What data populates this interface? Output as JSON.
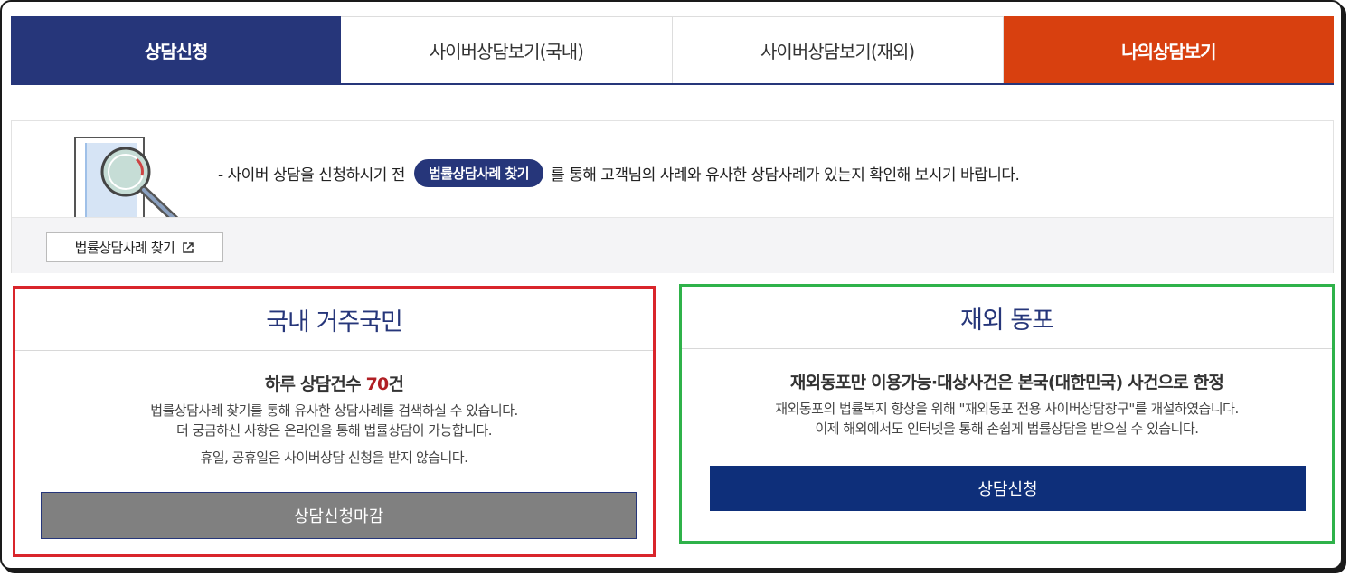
{
  "tabs": [
    {
      "label": "상담신청"
    },
    {
      "label": "사이버상담보기(국내)"
    },
    {
      "label": "사이버상담보기(재외)"
    },
    {
      "label": "나의상담보기"
    }
  ],
  "notice": {
    "prefix": "- 사이버 상담을 신청하시기 전",
    "pill_label": "법률상담사례 찾기",
    "suffix": "를 통해 고객님의 사례와 유사한 상담사례가 있는지 확인해 보시기 바랍니다.",
    "find_button": "법률상담사례 찾기",
    "illustration_icon": "document-magnifier-icon",
    "external_icon": "external-link-icon"
  },
  "domestic": {
    "title": "국내 거주국민",
    "count_prefix": "하루 상담건수 ",
    "count_value": "70",
    "count_suffix": "건",
    "desc_line1": "법률상담사례 찾기를 통해 유사한 상담사례를 검색하실 수 있습니다.",
    "desc_line2": "더 궁금하신 사항은 온라인을 통해 법률상담이 가능합니다.",
    "holiday_note": "휴일, 공휴일은 사이버상담 신청을 받지 않습니다.",
    "button_label": "상담신청마감"
  },
  "overseas": {
    "title": "재외 동포",
    "subtitle": "재외동포만 이용가능·대상사건은 본국(대한민국) 사건으로 한정",
    "desc_line1": "재외동포의 법률복지 향상을 위해 \"재외동포 전용 사이버상담창구\"를 개설하였습니다.",
    "desc_line2": "이제 해외에서도 인터넷을 통해 손쉽게 법률상담을 받으실 수 있습니다.",
    "button_label": "상담신청"
  },
  "colors": {
    "navy": "#26367a",
    "orange": "#d8400f",
    "red_outline": "#d9252b",
    "green_outline": "#2fb24a",
    "closed_gray": "#808080",
    "apply_blue": "#0e2f7a"
  }
}
